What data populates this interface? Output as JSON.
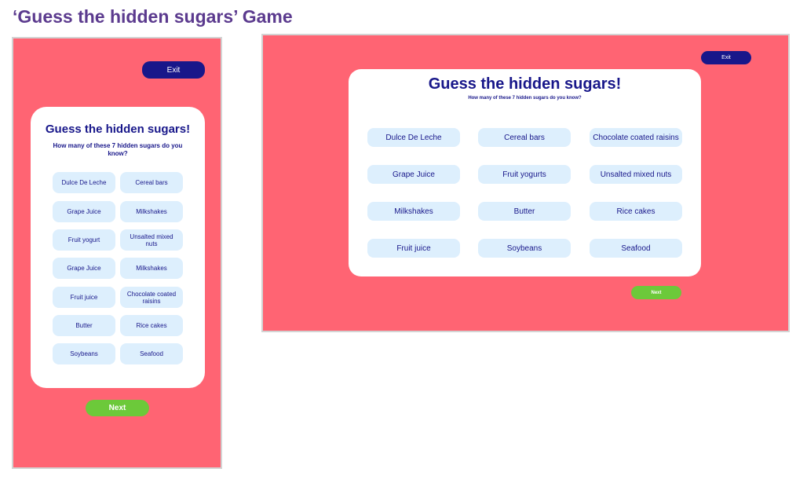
{
  "page": {
    "heading": "‘Guess the hidden sugars’ Game"
  },
  "colors": {
    "panel_bg": "#ff6473",
    "primary": "#18178a",
    "option_bg": "#ddeffd",
    "next_bg": "#6cc93a",
    "heading": "#5b3a8e"
  },
  "mobile": {
    "exit_label": "Exit",
    "title": "Guess the hidden sugars!",
    "subtitle": "How many of these 7 hidden sugars do you know?",
    "options": [
      "Dulce De Leche",
      "Cereal bars",
      "Grape Juice",
      "Milkshakes",
      "Fruit yogurt",
      "Unsalted mixed nuts",
      "Grape Juice",
      "Milkshakes",
      "Fruit juice",
      "Chocolate coated raisins",
      "Butter",
      "Rice cakes",
      "Soybeans",
      "Seafood"
    ],
    "next_label": "Next"
  },
  "desktop": {
    "exit_label": "Exit",
    "title": "Guess the hidden sugars!",
    "subtitle": "How many of these 7 hidden sugars do you know?",
    "options": [
      "Dulce De Leche",
      "Cereal bars",
      "Chocolate coated raisins",
      "Grape Juice",
      "Fruit yogurts",
      "Unsalted mixed nuts",
      "Milkshakes",
      "Butter",
      "Rice cakes",
      "Fruit juice",
      "Soybeans",
      "Seafood"
    ],
    "next_label": "Next"
  }
}
